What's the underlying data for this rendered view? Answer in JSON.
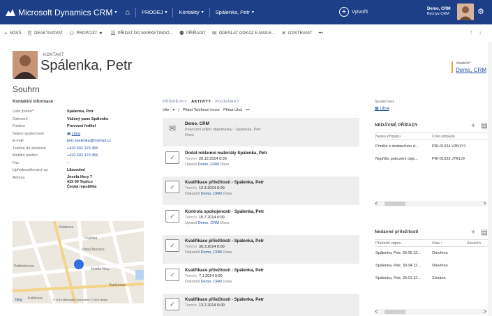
{
  "nav": {
    "app_title": "Microsoft Dynamics CRM",
    "area": "PRODEJ",
    "entity": "Kontakty",
    "record": "Spálenka, Petr",
    "create_label": "Vytvořit",
    "user_name": "Demo, CRM",
    "user_org": "Bycnys CRM"
  },
  "commands": [
    {
      "icon": "plus-icon",
      "glyph": "+",
      "label": "NOVÁ"
    },
    {
      "icon": "deactivate-icon",
      "glyph": "⎘",
      "label": "DEAKTIVOVAT"
    },
    {
      "icon": "connect-icon",
      "glyph": "⚇",
      "label": "PROPOJIT"
    },
    {
      "icon": "marketing-list-icon",
      "glyph": "☰",
      "label": "PŘIDAT DO MARKETINGO..."
    },
    {
      "icon": "assign-icon",
      "glyph": "⚉",
      "label": "PŘIŘADIT"
    },
    {
      "icon": "email-link-icon",
      "glyph": "✉",
      "label": "ODESLAT ODKAZ E-MAILE..."
    },
    {
      "icon": "delete-icon",
      "glyph": "✕",
      "label": "ODSTRANIT"
    },
    {
      "icon": "more-icon",
      "glyph": "",
      "label": "•••"
    }
  ],
  "header": {
    "record_type": "KONTAKT",
    "record_name": "Spálenka, Petr",
    "owner_label": "Vlastník",
    "owner_value": "Demo, CRM"
  },
  "section_title": "Souhrn",
  "contact_info": {
    "title": "Kontaktní informace",
    "fields": [
      {
        "label": "Celé jméno",
        "required": "*",
        "value": "Spálenka, Petr",
        "style": "bold"
      },
      {
        "label": "Oslovení",
        "required": "",
        "value": "Vážený pane Spálenko",
        "style": "bold"
      },
      {
        "label": "Funkce",
        "required": "",
        "value": "Provozní ředitel",
        "style": "bold"
      },
      {
        "label": "Název společnosti",
        "required": "",
        "value": "Libra",
        "style": "link"
      },
      {
        "label": "E-mail",
        "required": "",
        "value": "petr.spalenka@hotmail.cz",
        "style": "link"
      },
      {
        "label": "Telefon do zaměstn",
        "required": "",
        "value": "+420 602 123 456",
        "style": "link"
      },
      {
        "label": "Mobilní telefon",
        "required": "",
        "value": "+420 602 123 456",
        "style": "link"
      },
      {
        "label": "Fax",
        "required": "",
        "value": "--",
        "style": ""
      },
      {
        "label": "Upřednostňovaný zp",
        "required": "",
        "value": "Libovolné",
        "style": "bold"
      }
    ],
    "address_label": "Adresa",
    "address_lines": [
      "Josefa Hory 7",
      "415 00 Teplice",
      "Česká republika"
    ]
  },
  "map": {
    "streets": [
      "Jiráskova",
      "Pražská",
      "Petra Bezruče",
      "Josefa Hory",
      "Vančurova",
      "Potěmkinova",
      "Kollárova"
    ],
    "copyright": "© 2014 Microsoft Corporation   © 2014 Nokia",
    "brand": "bing"
  },
  "activities": {
    "tabs": [
      "PŘÍSPĚVKY",
      "AKTIVITY",
      "POZNÁMKY"
    ],
    "active_tab": "AKTIVITY",
    "toolbar": [
      "Vše",
      "▾",
      "|",
      "Přidat Telefonní hovor",
      "Přidat Úkol",
      "•••"
    ],
    "items": [
      {
        "type": "email",
        "title": "Demo, CRM",
        "subtitle": "Potvrzení přijetí objednávky - Spálenka, Petr",
        "meta": "Dnes",
        "due_label": "",
        "due": "",
        "by_label": "",
        "by": "",
        "when": ""
      },
      {
        "type": "task",
        "title": "Dodat reklamní materiály Spálenka, Petr",
        "subtitle": "",
        "meta": "",
        "due_label": "Termín",
        "due": "20.12.2014 0:00",
        "by_label": "Upravil",
        "by": "Demo, CRM",
        "when": "Dnes"
      },
      {
        "type": "task",
        "title": "Kvalifikace příležitosti - Spálenka, Petr",
        "subtitle": "",
        "meta": "",
        "due_label": "Termín",
        "due": "12.3.2014 0:00",
        "by_label": "Dokončil",
        "by": "Demo, CRM",
        "when": "Dnes"
      },
      {
        "type": "task",
        "title": "Kontrola spokojenosti - Spálenka, Petr",
        "subtitle": "",
        "meta": "",
        "due_label": "Termín",
        "due": "15.7.2014 0:00",
        "by_label": "Upravil",
        "by": "Demo, CRM",
        "when": "Dnes"
      },
      {
        "type": "task",
        "title": "Kvalifikace příležitosti - Spálenka, Petr",
        "subtitle": "",
        "meta": "",
        "due_label": "Termín",
        "due": "30.3.2014 0:00",
        "by_label": "Dokončil",
        "by": "Demo, CRM",
        "when": "Dnes"
      },
      {
        "type": "task",
        "title": "Kvalifikace příležitosti - Spálenka, Petr",
        "subtitle": "",
        "meta": "",
        "due_label": "Termín",
        "due": "7.1.2014 0:00",
        "by_label": "Dokončil",
        "by": "Demo, CRM",
        "when": "Dnes"
      },
      {
        "type": "task",
        "title": "Kvalifikace příležitosti - Spálenka, Petr",
        "subtitle": "",
        "meta": "",
        "due_label": "Termín",
        "due": "13.2.2014 0:00",
        "by_label": "",
        "by": "",
        "when": ""
      }
    ]
  },
  "company": {
    "label": "Společnost",
    "value": "Libra"
  },
  "cases": {
    "title": "NEDÁVNÉ PŘÍPADY",
    "columns": [
      "Název případu",
      "Číslo případu"
    ],
    "rows": [
      [
        "Prosba o dodatečnou d...",
        "PŘÍ-01034-V3N1Y1"
      ],
      [
        "Nepřišlo potvrzení obje...",
        "PŘÍ-01033-J7R1J9"
      ]
    ]
  },
  "opportunities": {
    "title": "Nedávné příležitosti",
    "columns": [
      "Předmět zájmu",
      "Stav ↑",
      "Skutečn"
    ],
    "rows": [
      [
        "Spálenka, Petr, 30.05.12...",
        "Otevřeno",
        ""
      ],
      [
        "Spálenka, Petr, 30.04.12...",
        "Otevřeno",
        ""
      ],
      [
        "Spálenka, Petr, 30.01.12...",
        "Získáno",
        ""
      ]
    ]
  },
  "colors": {
    "nav_bg": "#1c3f87",
    "link": "#1f4e9d",
    "owner_accent": "#e4a23a",
    "map_marker": "#2f6fe0"
  }
}
